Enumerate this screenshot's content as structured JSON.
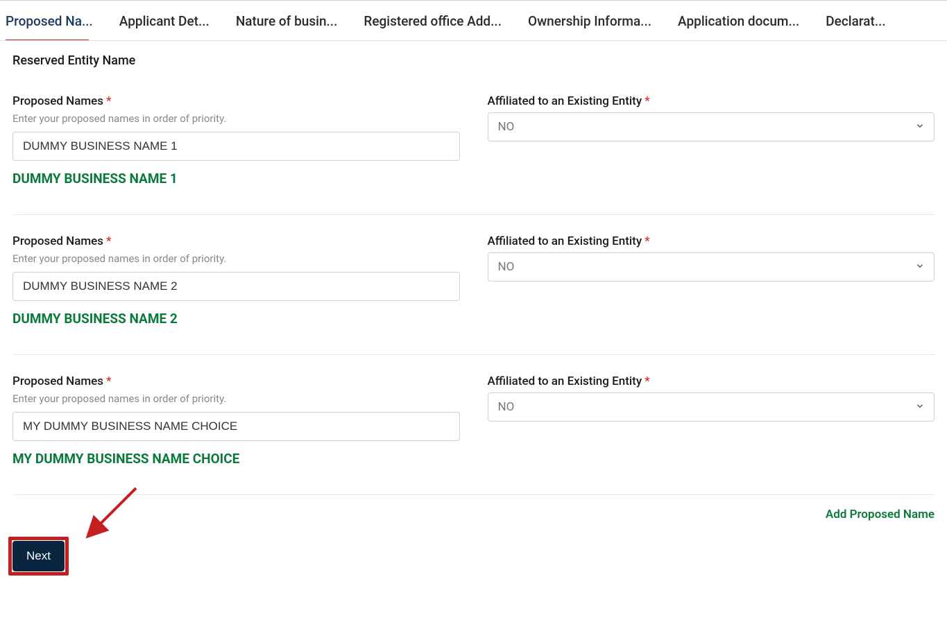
{
  "tabs": [
    {
      "label": "Proposed Na...",
      "active": true
    },
    {
      "label": "Applicant Det...",
      "active": false
    },
    {
      "label": "Nature of busin...",
      "active": false
    },
    {
      "label": "Registered office Add...",
      "active": false
    },
    {
      "label": "Ownership Informa...",
      "active": false
    },
    {
      "label": "Application docum...",
      "active": false
    },
    {
      "label": "Declarat...",
      "active": false
    }
  ],
  "section_title": "Reserved Entity Name",
  "proposed_label": "Proposed Names",
  "helper_text": "Enter your proposed names in order of priority.",
  "affiliated_label": "Affiliated to an Existing Entity",
  "entries": [
    {
      "name": "DUMMY BUSINESS NAME 1",
      "affiliated": "NO",
      "confirmed": "DUMMY BUSINESS NAME 1"
    },
    {
      "name": "DUMMY BUSINESS NAME 2",
      "affiliated": "NO",
      "confirmed": "DUMMY BUSINESS NAME 2"
    },
    {
      "name": "MY DUMMY BUSINESS NAME CHOICE",
      "affiliated": "NO",
      "confirmed": "MY DUMMY BUSINESS NAME CHOICE"
    }
  ],
  "add_proposed_label": "Add Proposed Name",
  "next_label": "Next",
  "required_marker": "*"
}
